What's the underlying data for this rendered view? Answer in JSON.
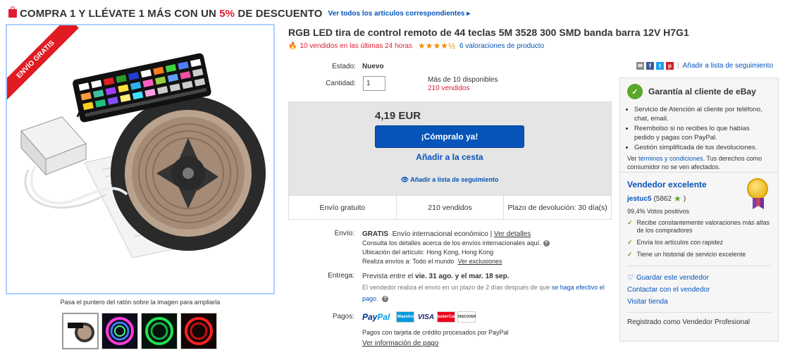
{
  "promo": {
    "title_start": "COMPRA 1 Y LLÉVATE 1 MÁS CON UN ",
    "percent": "5%",
    "title_end": " DE DESCUENTO",
    "link": "Ver todos los artículos correspondientes ▸"
  },
  "gallery": {
    "ribbon": "ENVÍO GRATIS",
    "hover_hint": "Pasa el puntero del ratón sobre la imagen para ampliarla",
    "thumb_count": 4
  },
  "product": {
    "title": "RGB LED tira de control remoto de 44 teclas 5M 3528 300 SMD banda barra 12V H7G1",
    "hot_text": "10 vendidos en las últimas 24 horas",
    "rating": 4.5,
    "stars": "★★★★½",
    "reviews": "6 valoraciones de producto"
  },
  "form": {
    "state_label": "Estado:",
    "state_value": "Nuevo",
    "qty_label": "Cantidad:",
    "qty_value": "1",
    "available": "Más de 10 disponibles",
    "sold": "210 vendidos"
  },
  "buy": {
    "price": "4,19 EUR",
    "buy_now": "¡Cómpralo ya!",
    "add_cart": "Añadir a la cesta",
    "watch": "Añadir a lista de seguimiento"
  },
  "strip": [
    "Envío gratuito",
    "210 vendidos",
    "Plazo de devolución: 30 día(s)"
  ],
  "shipping": {
    "label": "Envío:",
    "free": "GRATIS",
    "method": "Envío internacional económico",
    "details_link": "Ver detalles",
    "consult": "Consulta los detalles acerca de los envíos internacionales aquí.",
    "location_label": "Ubicación del artículo:",
    "location": "Hong Kong, Hong Kong",
    "ships_label": "Realiza envíos a:",
    "ships_to": "Todo el mundo",
    "exclusions": "Ver exclusiones"
  },
  "delivery": {
    "label": "Entrega:",
    "estimate_prefix": "Prevista entre el",
    "date1": "vie. 31 ago.",
    "and": "y el",
    "date2": "mar. 18 sep.",
    "note": "El vendedor realiza el envío en un plazo de 2 días después de que",
    "note_link": "se haga efectivo el pago",
    "note_end": "."
  },
  "payments": {
    "label": "Pagos:",
    "paypal_a": "Pay",
    "paypal_b": "Pal",
    "maestro": "Maestro",
    "visa": "VISA",
    "mastercard": "MasterCard",
    "discover": "DISCOVER",
    "processed": "Pagos con tarjeta de crédito procesados por PayPal",
    "info_link": "Ver información de pago"
  },
  "share": {
    "watch_link": "Añadir a lista de seguimiento"
  },
  "guarantee": {
    "title": "Garantía al cliente de eBay",
    "items": [
      "Servicio de Atención al cliente por teléfono, chat, email.",
      "Reembolso si no recibes lo que habías pedido y pagas con PayPal.",
      "Gestión simplificada de tus devoluciones."
    ],
    "foot_a": "Ver",
    "foot_link": "términos y condiciones",
    "foot_b": ". Tus derechos como consumidor no se ven afectados."
  },
  "seller": {
    "title": "Vendedor excelente",
    "id": "jestuc5",
    "score": "(5862",
    "score_end": ")",
    "positive": "99,4% Votos positivos",
    "checks": [
      "Recibe constantemente valoraciones más altas de los compradores",
      "Envía los artículos con rapidez",
      "Tiene un historial de servicio excelente"
    ],
    "save": "Guardar este vendedor",
    "contact": "Contactar con el vendedor",
    "store": "Visitar tienda",
    "registered": "Registrado como Vendedor Profesional"
  }
}
